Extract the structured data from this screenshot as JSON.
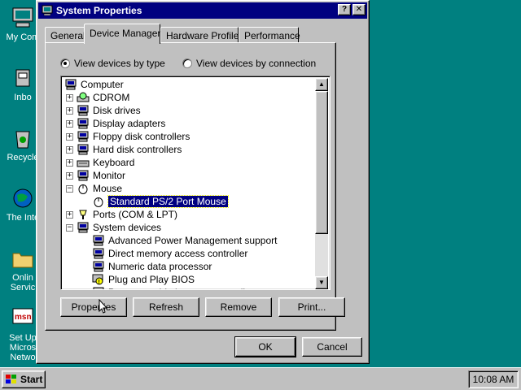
{
  "desktop": {
    "icons": [
      {
        "label": "My Com",
        "icon": "my-computer-icon"
      },
      {
        "label": "Inbo",
        "icon": "inbox-icon"
      },
      {
        "label": "Recycle",
        "icon": "recycle-bin-icon"
      },
      {
        "label": "The Inte",
        "icon": "internet-icon"
      },
      {
        "label": "Onlin",
        "label2": "Servic",
        "icon": "online-services-folder-icon"
      },
      {
        "label": "Set Up",
        "label2": "Micros",
        "label3": "Netwo",
        "icon": "msn-icon",
        "badge": "msn"
      }
    ]
  },
  "dialog": {
    "title": "System Properties",
    "help_button": "?",
    "close_button": "✕",
    "tabs": [
      "General",
      "Device Manager",
      "Hardware Profiles",
      "Performance"
    ],
    "active_tab": "Device Manager",
    "view_by_type": "View devices by type",
    "view_by_connection": "View devices by connection",
    "tree": [
      {
        "label": "Computer",
        "expander": "",
        "icon": "computer-icon"
      },
      {
        "label": "CDROM",
        "expander": "+",
        "icon": "cdrom-icon"
      },
      {
        "label": "Disk drives",
        "expander": "+",
        "icon": "disk-drive-icon"
      },
      {
        "label": "Display adapters",
        "expander": "+",
        "icon": "display-adapter-icon"
      },
      {
        "label": "Floppy disk controllers",
        "expander": "+",
        "icon": "floppy-controller-icon"
      },
      {
        "label": "Hard disk controllers",
        "expander": "+",
        "icon": "hard-disk-controller-icon"
      },
      {
        "label": "Keyboard",
        "expander": "+",
        "icon": "keyboard-icon"
      },
      {
        "label": "Monitor",
        "expander": "+",
        "icon": "monitor-icon"
      },
      {
        "label": "Mouse",
        "expander": "−",
        "icon": "mouse-icon"
      },
      {
        "label": "Standard PS/2 Port Mouse",
        "expander": "",
        "icon": "mouse-icon",
        "selected": true
      },
      {
        "label": "Ports (COM & LPT)",
        "expander": "+",
        "icon": "ports-icon"
      },
      {
        "label": "System devices",
        "expander": "−",
        "icon": "system-devices-icon"
      },
      {
        "label": "Advanced Power Management support",
        "expander": "",
        "icon": "system-device-icon"
      },
      {
        "label": "Direct memory access controller",
        "expander": "",
        "icon": "system-device-icon"
      },
      {
        "label": "Numeric data processor",
        "expander": "",
        "icon": "system-device-icon"
      },
      {
        "label": "Plug and Play BIOS",
        "expander": "",
        "icon": "warning-device-icon"
      },
      {
        "label": "Programmable interrupt controller",
        "expander": "",
        "icon": "system-device-icon"
      }
    ],
    "buttons": {
      "properties": "Properties",
      "refresh": "Refresh",
      "remove": "Remove",
      "print": "Print...",
      "ok": "OK",
      "cancel": "Cancel"
    }
  },
  "taskbar": {
    "start": "Start",
    "clock": "10:08 AM"
  },
  "colors": {
    "desktop": "#008080",
    "titlebar": "#000080",
    "face": "#c0c0c0",
    "selection": "#000080"
  }
}
